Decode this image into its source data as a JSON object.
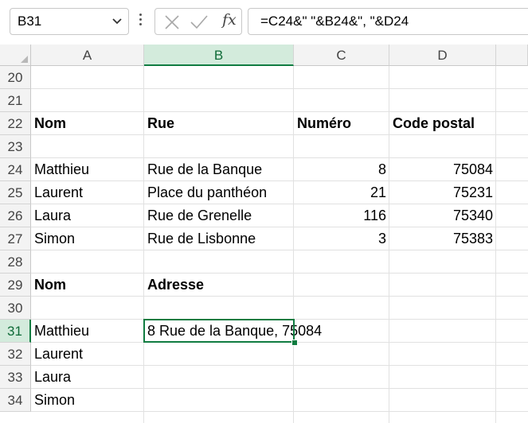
{
  "formula_bar": {
    "name_box": "B31",
    "fx_label": "fx",
    "formula": "=C24&\" \"&B24&\", \"&D24"
  },
  "columns": [
    "A",
    "B",
    "C",
    "D"
  ],
  "rows": [
    "20",
    "21",
    "22",
    "23",
    "24",
    "25",
    "26",
    "27",
    "28",
    "29",
    "30",
    "31",
    "32",
    "33",
    "34"
  ],
  "cells": {
    "A22": "Nom",
    "B22": "Rue",
    "C22": "Numéro",
    "D22": "Code postal",
    "A24": "Matthieu",
    "B24": "Rue de la Banque",
    "C24": "8",
    "D24": "75084",
    "A25": "Laurent",
    "B25": "Place du panthéon",
    "C25": "21",
    "D25": "75231",
    "A26": "Laura",
    "B26": "Rue de Grenelle",
    "C26": "116",
    "D26": "75340",
    "A27": "Simon",
    "B27": "Rue de Lisbonne",
    "C27": "3",
    "D27": "75383",
    "A29": "Nom",
    "B29": "Adresse",
    "A31": "Matthieu",
    "B31": "8 Rue de la Banque, 75084",
    "A32": "Laurent",
    "A33": "Laura",
    "A34": "Simon"
  },
  "selection": {
    "active_cell": "B31",
    "accent_color": "#107c41"
  }
}
